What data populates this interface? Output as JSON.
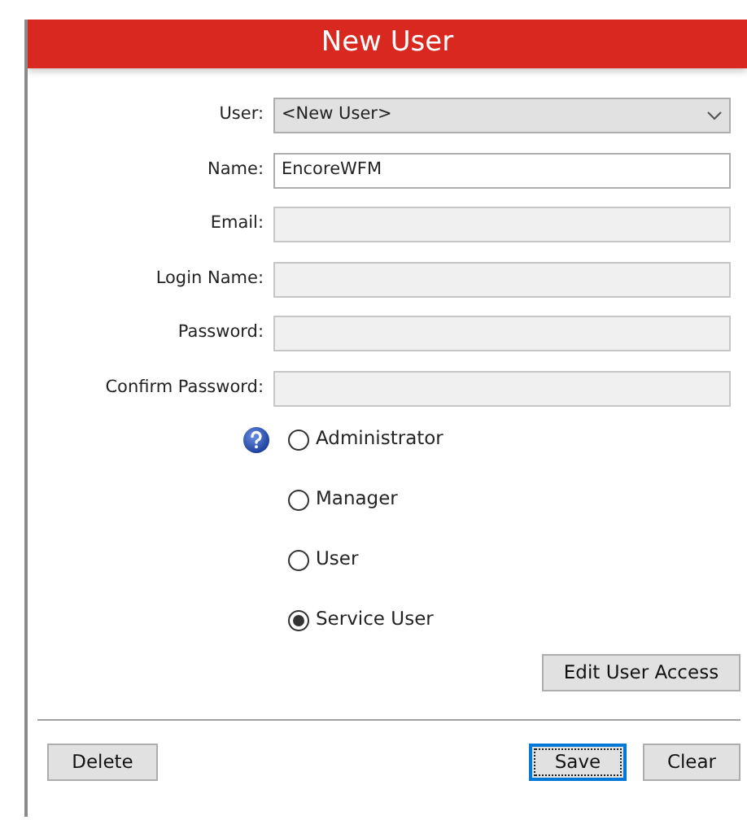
{
  "window": {
    "title": "New User"
  },
  "fields": [
    {
      "label": "User:",
      "kind": "select",
      "value": "<New User>",
      "disabled": false
    },
    {
      "label": "Name:",
      "kind": "text",
      "value": "EncoreWFM",
      "disabled": false
    },
    {
      "label": "Email:",
      "kind": "text",
      "disabled": true
    },
    {
      "label": "Login Name:",
      "kind": "text",
      "disabled": true
    },
    {
      "label": "Password:",
      "kind": "text",
      "disabled": true
    },
    {
      "label": "Confirm Password:",
      "kind": "text",
      "disabled": true
    }
  ],
  "roles": [
    {
      "label": "Administrator",
      "selected": false
    },
    {
      "label": "Manager",
      "selected": false
    },
    {
      "label": "User",
      "selected": false
    },
    {
      "label": "Service User",
      "selected": true
    }
  ],
  "edit_access_button": {
    "label": "Edit User Access",
    "focused": false
  },
  "buttons": [
    {
      "label": "Delete",
      "focused": false
    },
    {
      "label": "Save",
      "focused": true
    },
    {
      "label": "Clear",
      "focused": false
    }
  ]
}
